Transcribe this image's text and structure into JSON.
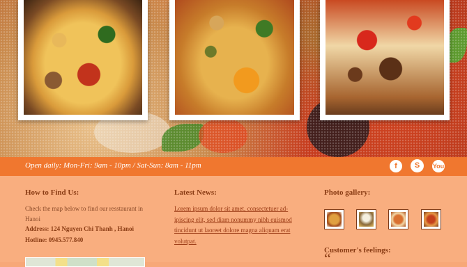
{
  "hero": {
    "photos": [
      {
        "name": "pizza-photo-1"
      },
      {
        "name": "pizza-photo-2"
      },
      {
        "name": "pizza-photo-3"
      }
    ]
  },
  "hours_bar": {
    "text": "Open daily: Mon-Fri: 9am - 10pm / Sat-Sun: 8am - 11pm",
    "social": {
      "facebook_glyph": "f",
      "skype_glyph": "S",
      "youtube_glyph": "You"
    }
  },
  "footer": {
    "find_us": {
      "title": "How to Find Us:",
      "description": "Check the map below to find our resstaurant in Hanoi",
      "address": "Address: 124 Nguyen Chi Thanh , Hanoi",
      "hotline": "Hotline: 0945.577.840"
    },
    "news": {
      "title": "Latest News:",
      "link_text": "Lorem ipsum dolor sit amet, consectetuer ad-ipiscing elit, sed diam nonummy nibh euismod tincidunt ut laoreet dolore magna aliquam erat volutpat."
    },
    "gallery": {
      "title": "Photo gallery:"
    },
    "feelings": {
      "title": "Customer's feelings:",
      "quote_mark": "“"
    }
  },
  "colors": {
    "accent": "#f0772f",
    "footer_bg": "#f9ae7f",
    "heading": "#8a3c14"
  },
  "icons": [
    "facebook-icon",
    "skype-icon",
    "youtube-icon",
    "quote-icon"
  ]
}
